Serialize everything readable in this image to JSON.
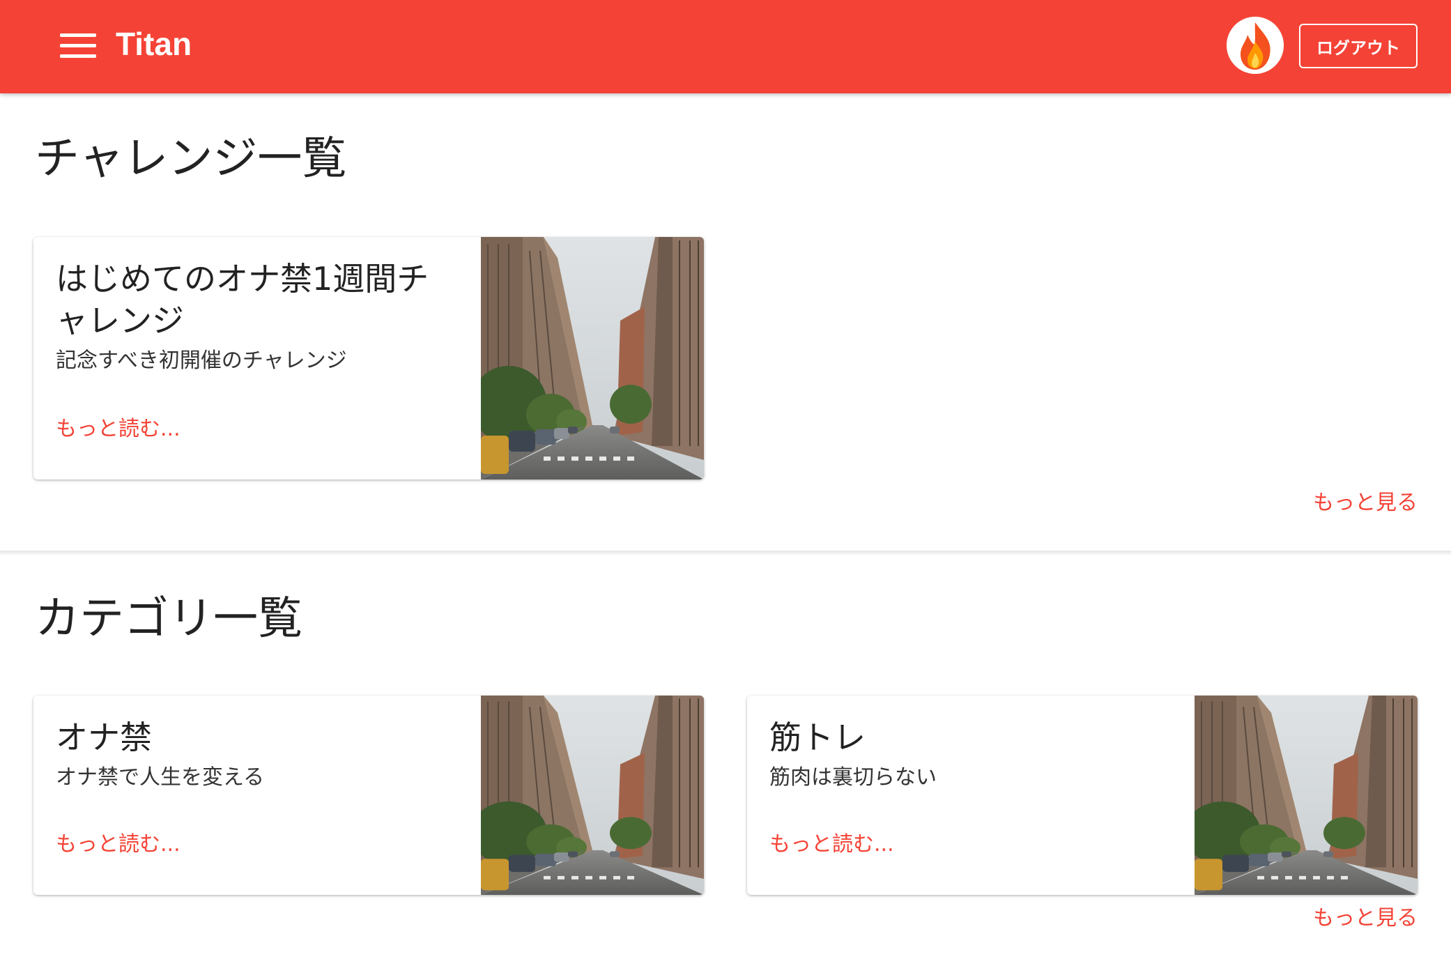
{
  "appbar": {
    "title": "Titan",
    "logout_label": "ログアウト",
    "color": "#f44336"
  },
  "challenges": {
    "heading": "チャレンジ一覧",
    "more_label": "もっと見る",
    "items": [
      {
        "title": "はじめてのオナ禁1週間チャレンジ",
        "subtitle": "記念すべき初開催のチャレンジ",
        "link_label": "もっと読む..."
      }
    ]
  },
  "categories": {
    "heading": "カテゴリ一覧",
    "more_label": "もっと見る",
    "items": [
      {
        "title": "オナ禁",
        "subtitle": "オナ禁で人生を変える",
        "link_label": "もっと読む..."
      },
      {
        "title": "筋トレ",
        "subtitle": "筋肉は裏切らない",
        "link_label": "もっと読む..."
      }
    ]
  },
  "icons": {
    "menu": "menu-icon",
    "avatar": "flame-icon",
    "card_image": "city-street-photo"
  }
}
